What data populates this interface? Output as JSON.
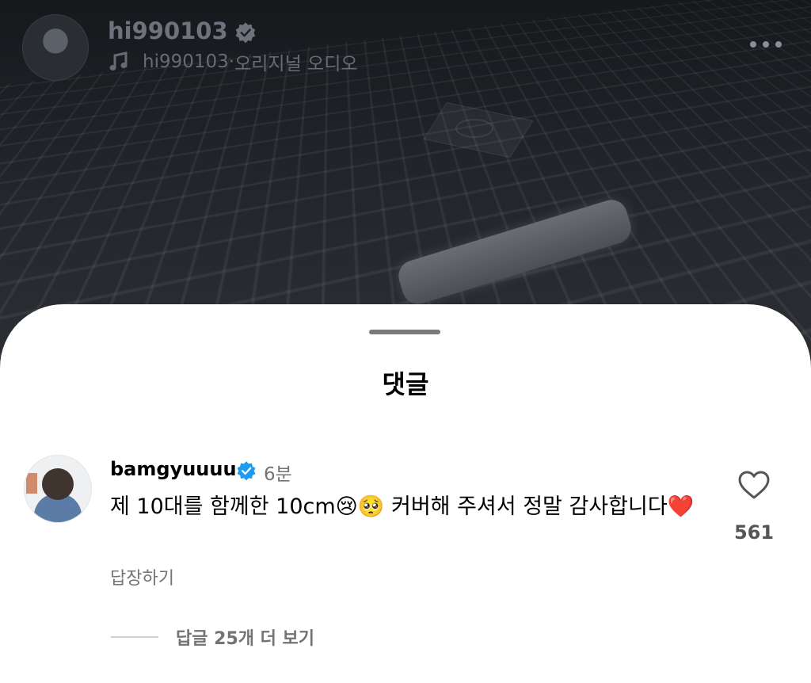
{
  "header": {
    "username": "hi990103",
    "audio_author": "hi990103",
    "audio_separator": " · ",
    "audio_label": "오리지널 오디오"
  },
  "icons": {
    "verified": "verified-badge-icon",
    "music": "music-note-icon",
    "more": "more-dots-icon",
    "heart": "heart-outline-icon"
  },
  "colors": {
    "verified_blue": "#1d9bf0",
    "sheet_bg": "#ffffff",
    "muted_text": "#737373"
  },
  "sheet": {
    "title": "댓글"
  },
  "comment": {
    "author": "bamgyuuuu",
    "time": "6분",
    "text": "제 10대를 함께한 10cm😢🥺 커버해 주셔서 정말 감사합니다❤️",
    "reply_label": "답장하기",
    "like_count": "561",
    "view_replies_label": "답글 25개 더 보기"
  }
}
